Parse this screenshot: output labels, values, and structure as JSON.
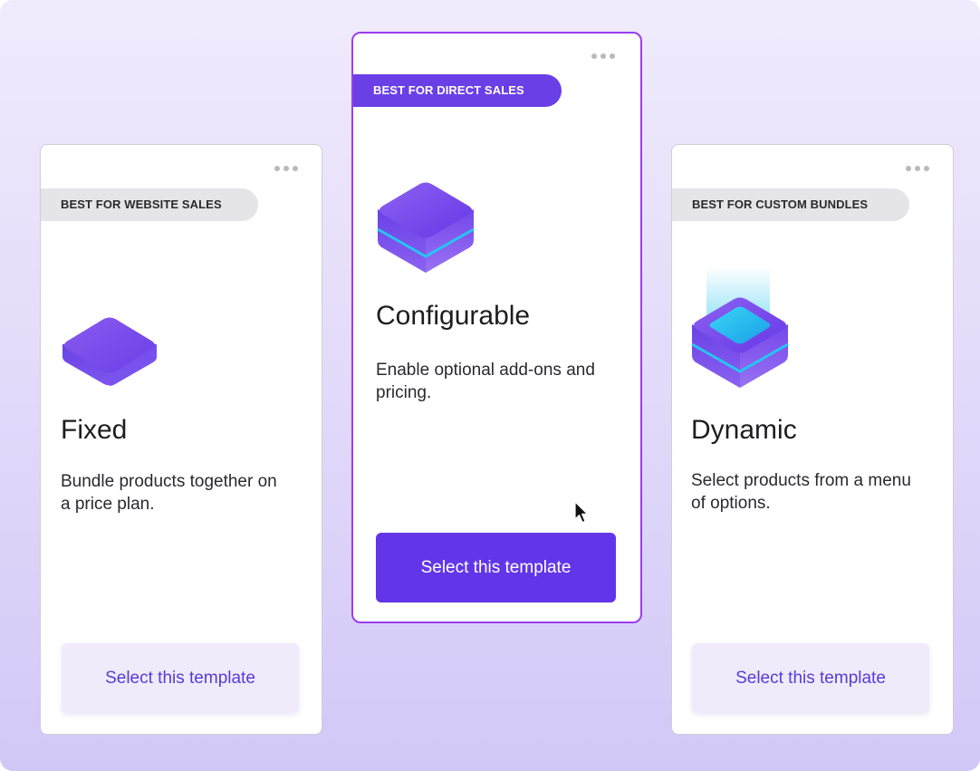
{
  "cards": [
    {
      "badge": "BEST FOR WEBSITE SALES",
      "title": "Fixed",
      "description": "Bundle products together on a price plan.",
      "button_label": "Select this template",
      "icon": "flat-tile-icon",
      "selected": false
    },
    {
      "badge": "BEST FOR DIRECT SALES",
      "title": "Configurable",
      "description": "Enable optional add-ons and pricing.",
      "button_label": "Select this template",
      "icon": "cube-icon",
      "selected": true
    },
    {
      "badge": "BEST FOR CUSTOM BUNDLES",
      "title": "Dynamic",
      "description": "Select products from a menu of options.",
      "button_label": "Select this template",
      "icon": "glowing-cube-icon",
      "selected": false
    }
  ],
  "colors": {
    "accent": "#6236e8",
    "selected_border": "#9b3df0",
    "soft_button_bg": "#efebfb",
    "soft_button_text": "#5a3ad6",
    "badge_bg": "#e5e5e8",
    "glow": "#27c4f0"
  },
  "cursor_icon": "mouse-pointer-icon"
}
